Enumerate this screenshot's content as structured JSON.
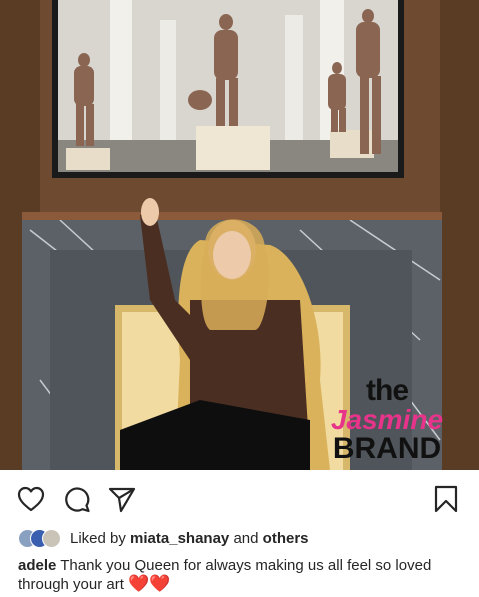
{
  "post": {
    "watermark": {
      "line1": "the",
      "line2": "Jasmine",
      "line3": "BRAND"
    }
  },
  "actions": [
    {
      "name": "like-button",
      "icon": "heart-icon"
    },
    {
      "name": "comment-button",
      "icon": "comment-bubble-icon"
    },
    {
      "name": "share-button",
      "icon": "paper-plane-icon"
    },
    {
      "name": "save-button",
      "icon": "bookmark-icon"
    }
  ],
  "likes": {
    "prefix": "Liked by",
    "user": "miata_shanay",
    "joiner": "and",
    "others": "others"
  },
  "caption": {
    "username": "adele",
    "text": "Thank you Queen for always making us all feel so loved through your art",
    "emoji": "❤️❤️"
  },
  "colors": {
    "accent_pink": "#e8338a",
    "heart_red": "#e0102b",
    "text": "#262626"
  }
}
